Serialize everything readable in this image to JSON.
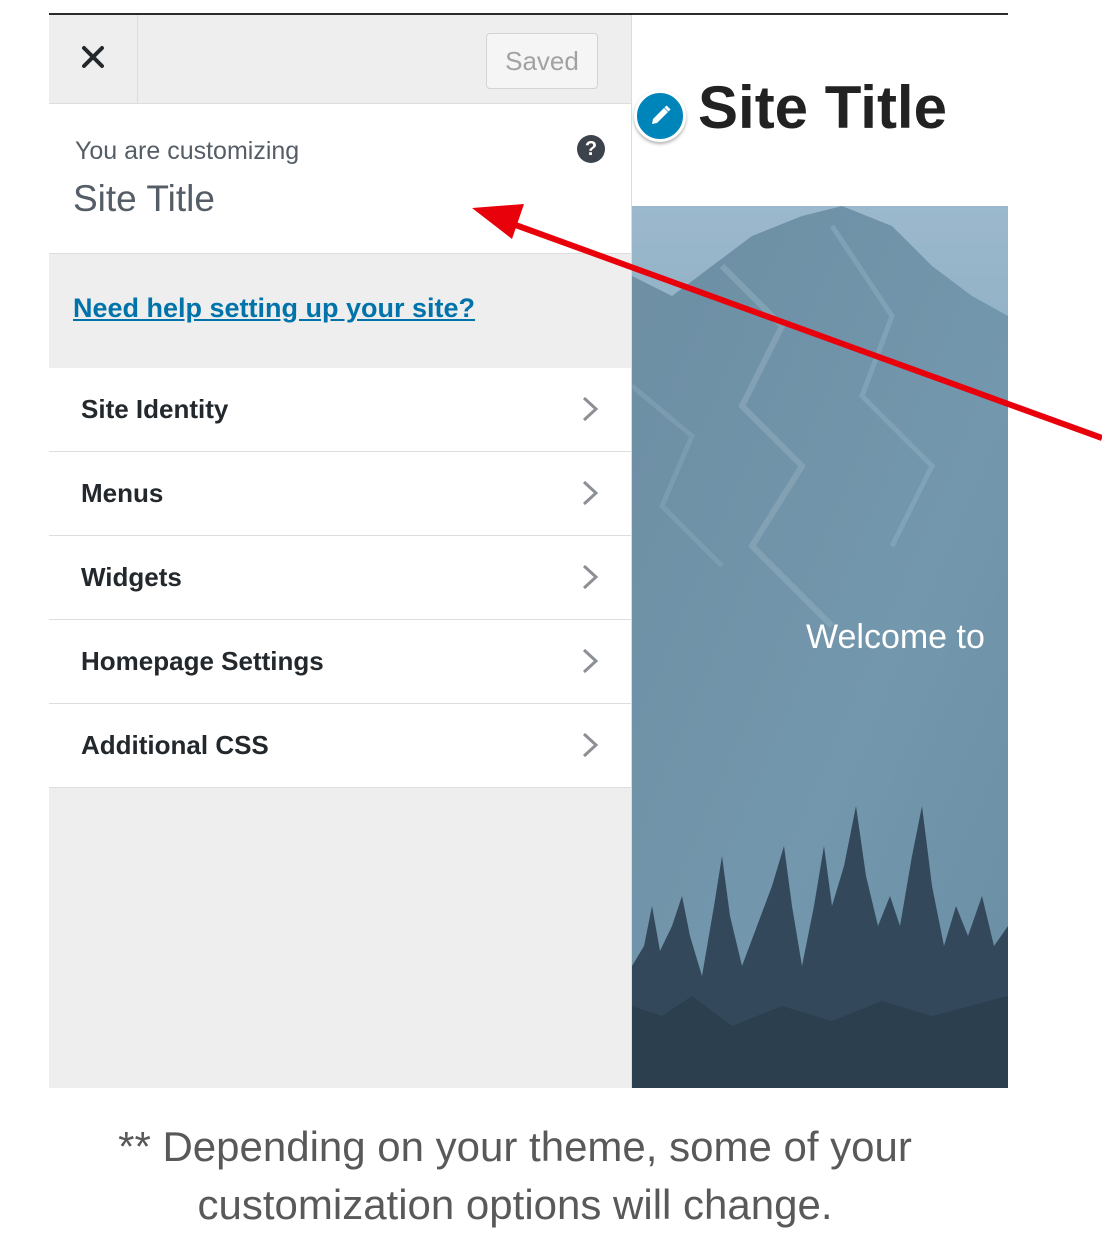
{
  "customizer": {
    "close_icon": "close-icon",
    "saved_label": "Saved",
    "customizing_label": "You are customizing",
    "customizing_value": "Site Title",
    "help_icon": "question-icon",
    "help_link": "Need help setting up your site?",
    "menu": [
      {
        "label": "Site Identity",
        "icon": "chevron-right-icon"
      },
      {
        "label": "Menus",
        "icon": "chevron-right-icon"
      },
      {
        "label": "Widgets",
        "icon": "chevron-right-icon"
      },
      {
        "label": "Homepage Settings",
        "icon": "chevron-right-icon"
      },
      {
        "label": "Additional CSS",
        "icon": "chevron-right-icon"
      }
    ]
  },
  "preview": {
    "edit_icon": "pencil-icon",
    "site_title": "Site Title",
    "hero_text": "Welcome to"
  },
  "caption": {
    "line1": "** Depending on your theme, some of your",
    "line2": "customization options will change."
  },
  "colors": {
    "accent": "#0073aa",
    "annotation_arrow": "#e8000b",
    "panel_bg": "#eeeeee"
  }
}
